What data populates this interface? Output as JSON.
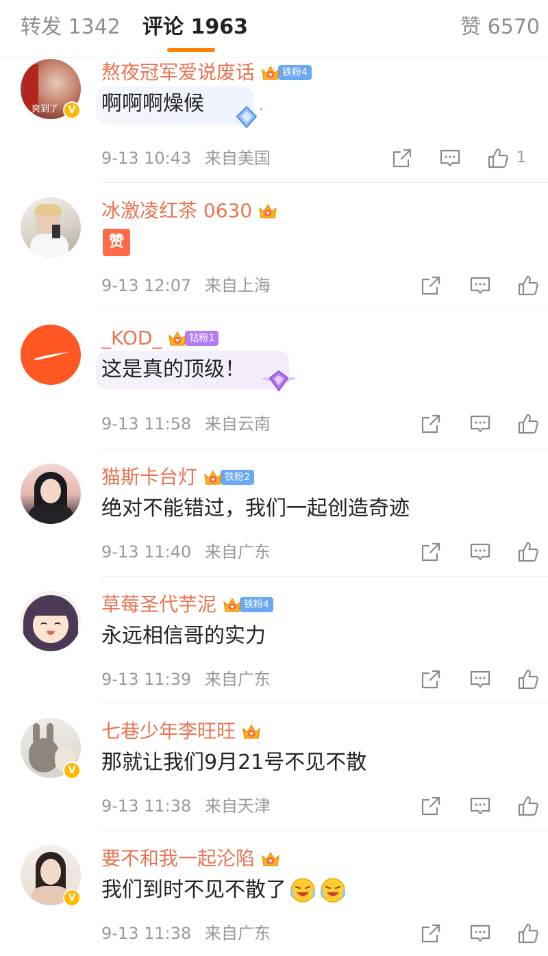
{
  "tabs": {
    "forward": "转发 1342",
    "comments": "评论 1963",
    "likes": "赞 6570"
  },
  "colors": {
    "accent": "#ff8200",
    "username": "#eb7350",
    "meta": "#999999",
    "iron_badge": "#6aa7f5",
    "diamond_badge": "#b57cf5"
  },
  "comments": [
    {
      "username": "熬夜冠军爱说废话",
      "badge": "铁粉4",
      "text": "啊啊啊燥候",
      "time": "9-13 10:43",
      "location": "来自美国",
      "likes": "1",
      "avatar_label": "爽到了"
    },
    {
      "username": "冰激凌红茶 0630",
      "badge": "",
      "text": "",
      "time": "9-13 12:07",
      "location": "来自上海",
      "likes": "",
      "sticker": "赞"
    },
    {
      "username": "_KOD_",
      "badge": "钻粉1",
      "text": "这是真的顶级！",
      "time": "9-13 11:58",
      "location": "来自云南",
      "likes": ""
    },
    {
      "username": "猫斯卡台灯",
      "badge": "铁粉2",
      "text": "绝对不能错过，我们一起创造奇迹",
      "time": "9-13 11:40",
      "location": "来自广东",
      "likes": ""
    },
    {
      "username": "草莓圣代芋泥",
      "badge": "铁粉4",
      "text": "永远相信哥的实力",
      "time": "9-13 11:39",
      "location": "来自广东",
      "likes": ""
    },
    {
      "username": "七巷少年李旺旺",
      "badge": "",
      "text": "那就让我们9月21号不见不散",
      "time": "9-13 11:38",
      "location": "来自天津",
      "likes": ""
    },
    {
      "username": "要不和我一起沦陷",
      "badge": "",
      "text": "我们到时不见不散了",
      "time": "9-13 11:38",
      "location": "来自广东",
      "likes": ""
    }
  ]
}
